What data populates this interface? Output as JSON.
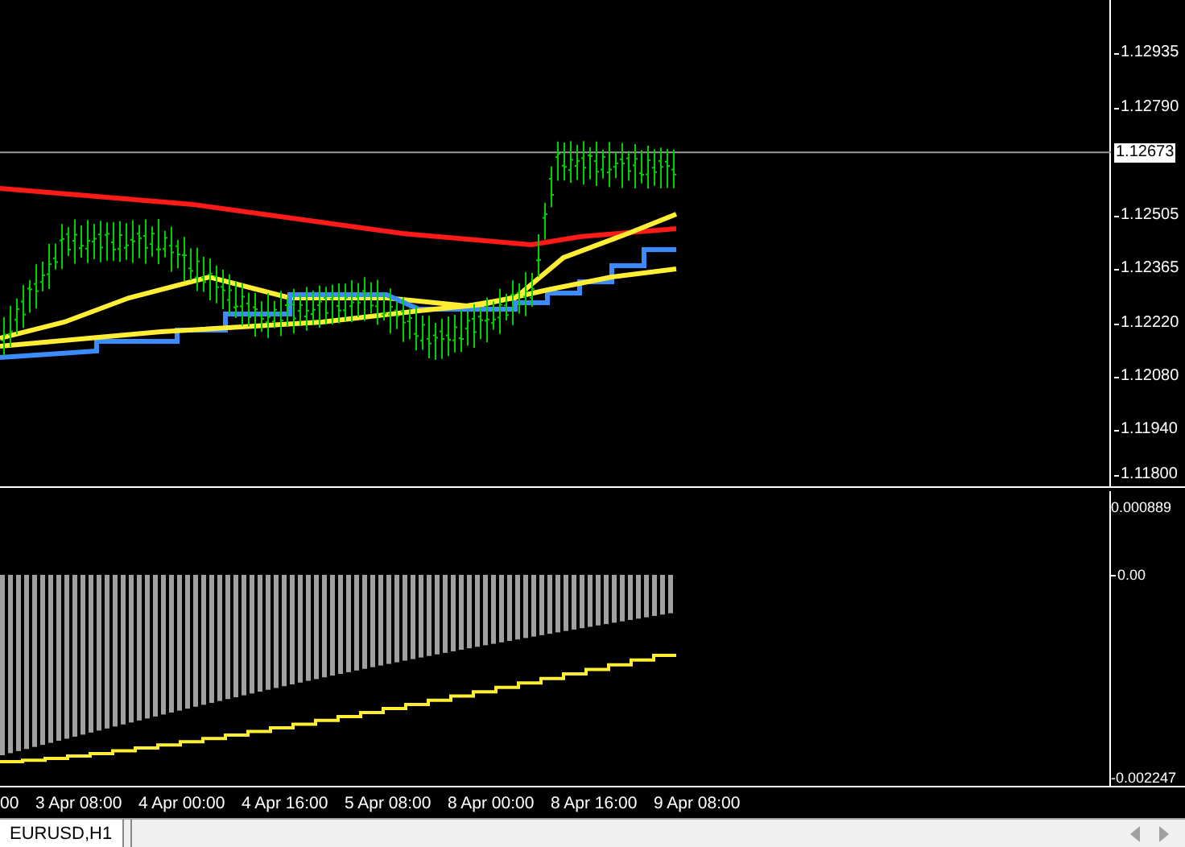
{
  "price_axis": {
    "labels": [
      "1.12935",
      "1.12790",
      "1.12505",
      "1.12365",
      "1.12220",
      "1.12080",
      "1.11940",
      "1.11800"
    ],
    "current_price": "1.12673"
  },
  "indicator_axis": {
    "labels": [
      "0.000889",
      "0.00",
      "-0.002247"
    ]
  },
  "time_axis": {
    "labels": [
      "00",
      "3 Apr 08:00",
      "4 Apr 00:00",
      "4 Apr 16:00",
      "5 Apr 08:00",
      "8 Apr 00:00",
      "8 Apr 16:00",
      "9 Apr 08:00"
    ]
  },
  "tabs": [
    {
      "label": "EURUSD,H1",
      "selected": true
    }
  ]
}
